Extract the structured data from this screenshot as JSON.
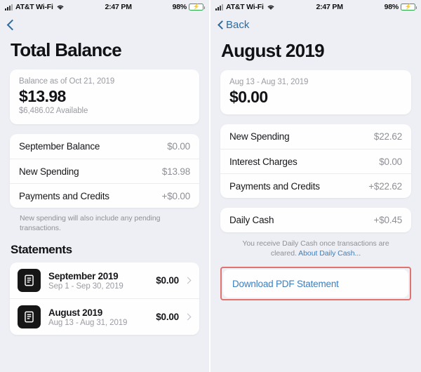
{
  "status_bar": {
    "carrier": "AT&T Wi-Fi",
    "time": "2:47 PM",
    "battery_percent": "98%",
    "signal_icon": "cellular-signal-icon",
    "wifi_icon": "wifi-icon",
    "battery_icon": "battery-charging-icon"
  },
  "colors": {
    "accent_blue": "#3b7fbe",
    "highlight_red": "#e0736e",
    "background": "#edeff4",
    "card": "#fefefe",
    "battery_green": "#4cd264"
  },
  "left_screen": {
    "nav": {
      "back_label": "",
      "back_icon": "chevron-left-icon"
    },
    "title": "Total Balance",
    "balance_card": {
      "subtitle": "Balance as of Oct 21, 2019",
      "amount": "$13.98",
      "available": "$6,486.02 Available"
    },
    "summary_rows": [
      {
        "label": "September Balance",
        "value": "$0.00"
      },
      {
        "label": "New Spending",
        "value": "$13.98"
      },
      {
        "label": "Payments and Credits",
        "value": "+$0.00"
      }
    ],
    "footnote": "New spending will also include any pending transactions.",
    "statements_heading": "Statements",
    "statements": [
      {
        "name": "September 2019",
        "range": "Sep 1 - Sep 30, 2019",
        "amount": "$0.00",
        "icon": "statement-document-icon",
        "chevron": "chevron-right-icon"
      },
      {
        "name": "August 2019",
        "range": "Aug 13 - Aug 31, 2019",
        "amount": "$0.00",
        "icon": "statement-document-icon",
        "chevron": "chevron-right-icon"
      }
    ]
  },
  "right_screen": {
    "nav": {
      "back_label": "Back",
      "back_icon": "chevron-left-icon"
    },
    "title": "August 2019",
    "balance_card": {
      "subtitle": "Aug 13 - Aug 31, 2019",
      "amount": "$0.00"
    },
    "summary_rows": [
      {
        "label": "New Spending",
        "value": "$22.62"
      },
      {
        "label": "Interest Charges",
        "value": "$0.00"
      },
      {
        "label": "Payments and Credits",
        "value": "+$22.62"
      }
    ],
    "daily_cash": {
      "label": "Daily Cash",
      "value": "+$0.45"
    },
    "daily_cash_note": "You receive Daily Cash once transactions are cleared. ",
    "daily_cash_link": "About Daily Cash...",
    "download_action": "Download PDF Statement"
  }
}
